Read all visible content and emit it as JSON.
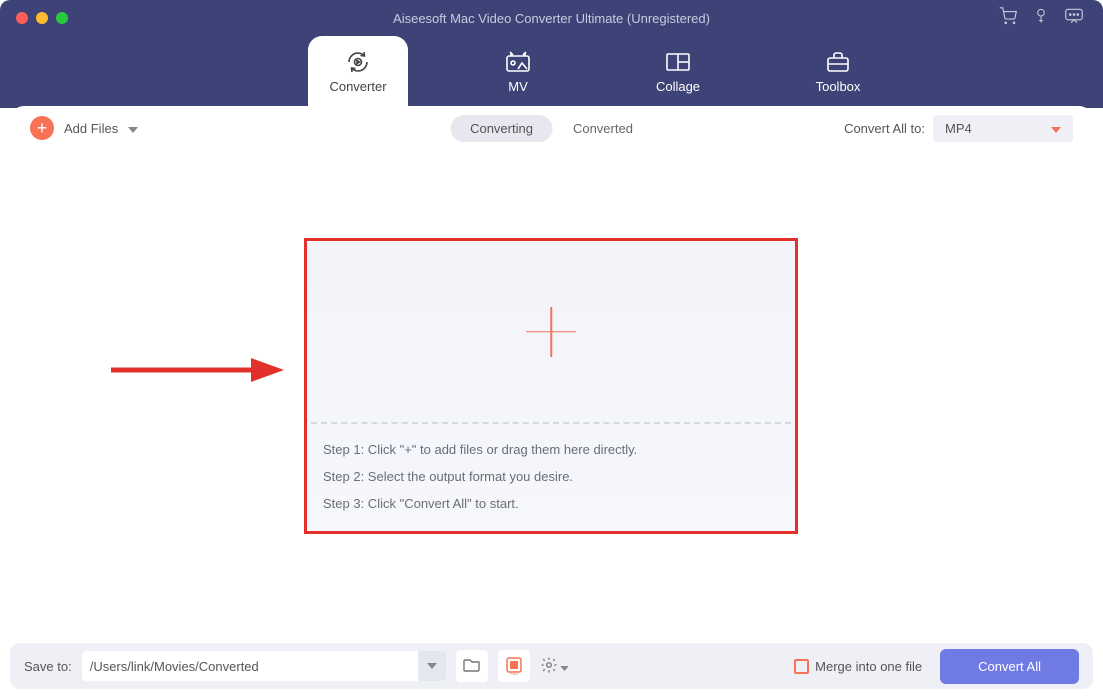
{
  "title": "Aiseesoft Mac Video Converter Ultimate (Unregistered)",
  "tabs": {
    "converter": "Converter",
    "mv": "MV",
    "collage": "Collage",
    "toolbox": "Toolbox"
  },
  "toolbar": {
    "add_files": "Add Files",
    "converting": "Converting",
    "converted": "Converted",
    "convert_all_to": "Convert All to:",
    "format": "MP4"
  },
  "dropzone": {
    "step1": "Step 1: Click \"+\" to add files or drag them here directly.",
    "step2": "Step 2: Select the output format you desire.",
    "step3": "Step 3: Click \"Convert All\" to start."
  },
  "footer": {
    "save_to_label": "Save to:",
    "save_path": "/Users/link/Movies/Converted",
    "merge_label": "Merge into one file",
    "convert_all": "Convert All"
  }
}
